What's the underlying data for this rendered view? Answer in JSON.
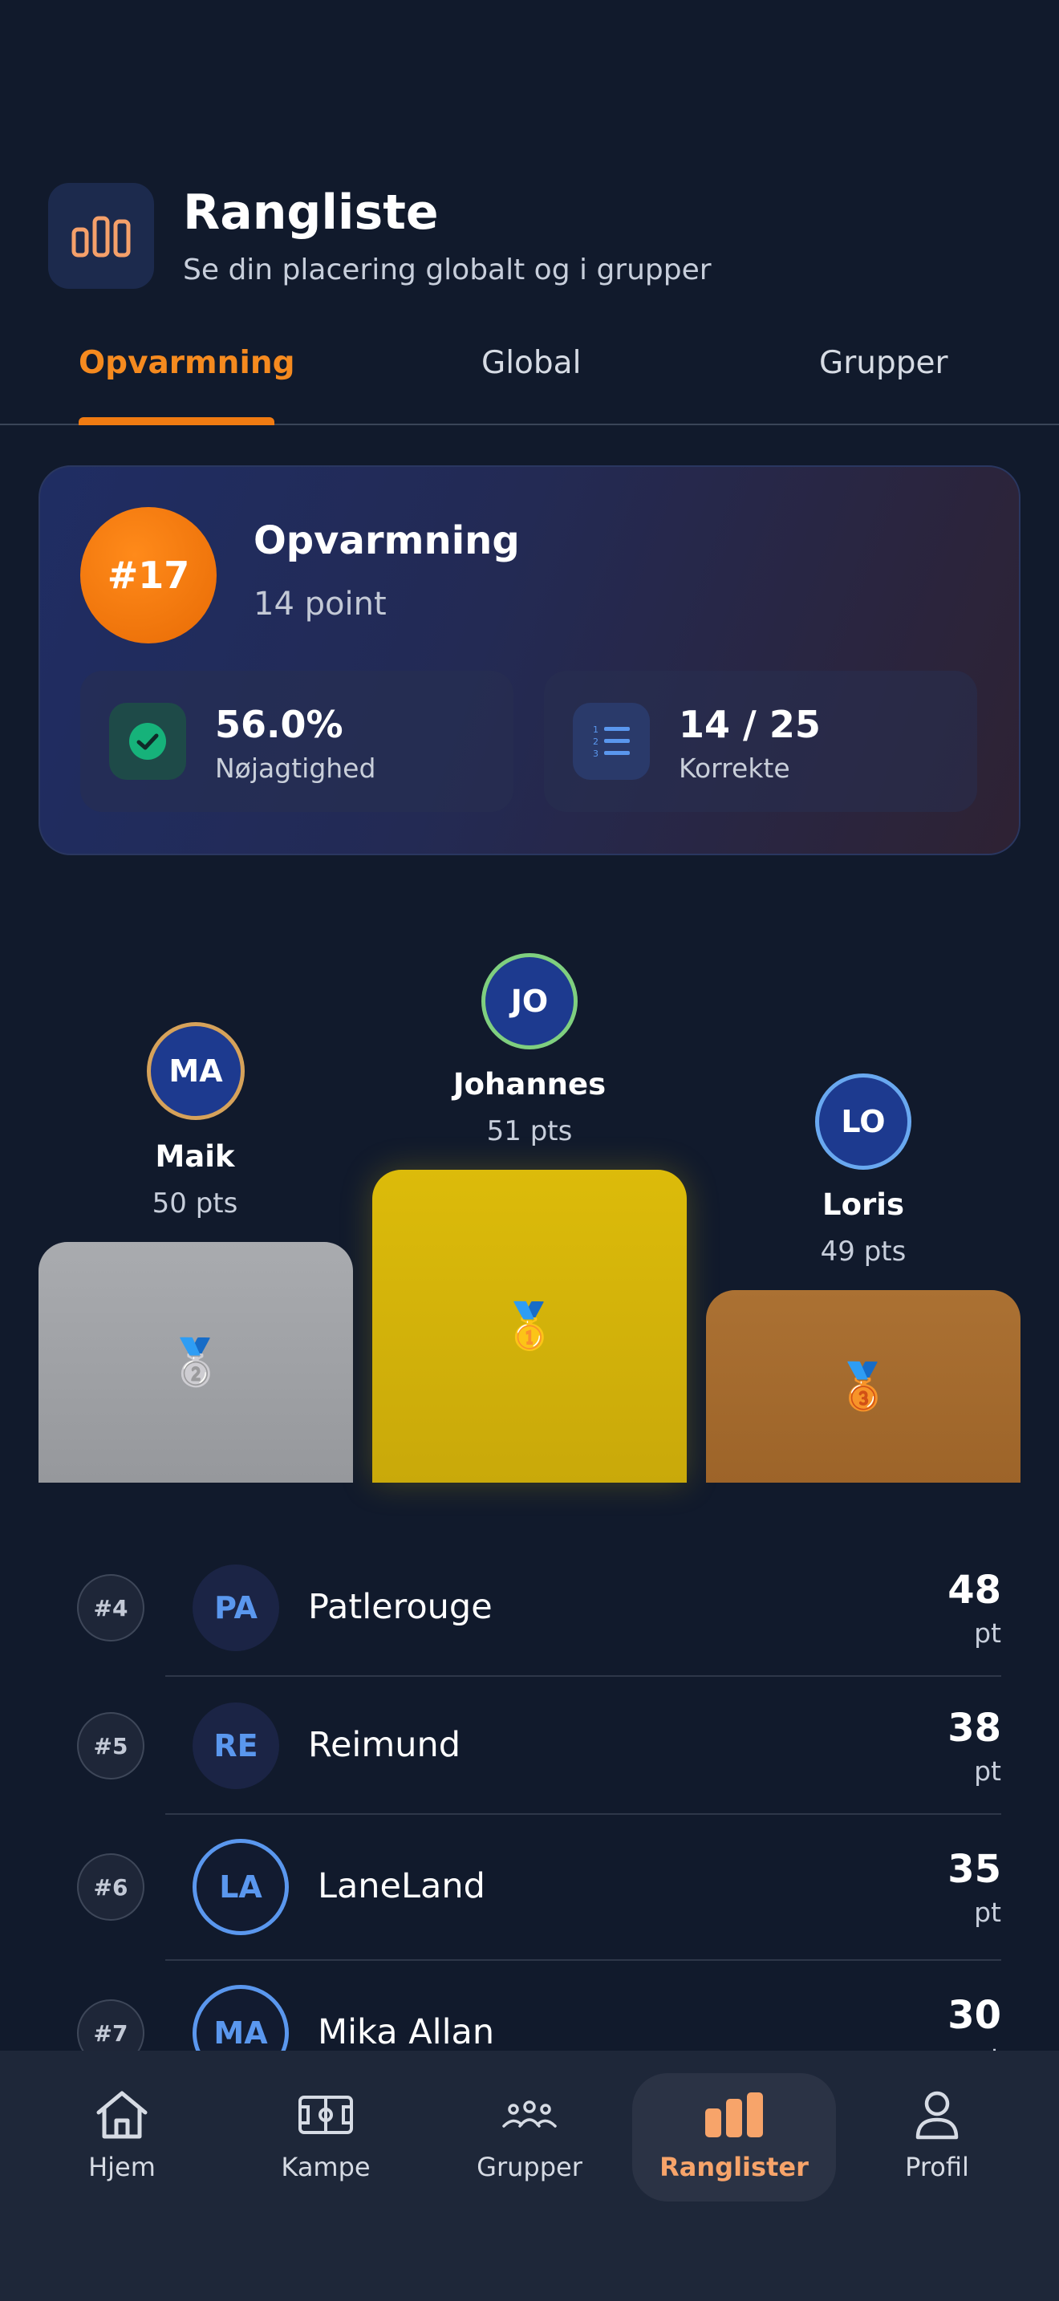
{
  "header": {
    "title": "Rangliste",
    "subtitle": "Se din placering globalt og i grupper",
    "icon": "bar-chart-icon"
  },
  "tabs": [
    {
      "label": "Opvarmning",
      "active": true
    },
    {
      "label": "Global",
      "active": false
    },
    {
      "label": "Grupper",
      "active": false
    }
  ],
  "summary": {
    "rank": "#17",
    "title": "Opvarmning",
    "points": "14 point",
    "stats": [
      {
        "value": "56.0%",
        "label": "Nøjagtighed",
        "icon": "check-circle-icon"
      },
      {
        "value": "14 / 25",
        "label": "Korrekte",
        "icon": "list-icon"
      }
    ]
  },
  "podium": {
    "first": {
      "initials": "JO",
      "name": "Johannes",
      "pts": "51 pts",
      "medal": "🥇"
    },
    "second": {
      "initials": "MA",
      "name": "Maik",
      "pts": "50 pts",
      "medal": "🥈"
    },
    "third": {
      "initials": "LO",
      "name": "Loris",
      "pts": "49 pts",
      "medal": "🥉"
    }
  },
  "leaderboard": [
    {
      "rank": "#4",
      "initials": "PA",
      "name": "Patlerouge",
      "score": "48",
      "unit": "pt"
    },
    {
      "rank": "#5",
      "initials": "RE",
      "name": "Reimund",
      "score": "38",
      "unit": "pt"
    },
    {
      "rank": "#6",
      "initials": "LA",
      "name": "LaneLand",
      "score": "35",
      "unit": "pt"
    },
    {
      "rank": "#7",
      "initials": "MA",
      "name": "Mika Allan",
      "score": "30",
      "unit": "pt"
    }
  ],
  "nav": [
    {
      "label": "Hjem",
      "icon": "home-icon",
      "active": false
    },
    {
      "label": "Kampe",
      "icon": "field-icon",
      "active": false
    },
    {
      "label": "Grupper",
      "icon": "people-icon",
      "active": false
    },
    {
      "label": "Ranglister",
      "icon": "leaderboard-icon",
      "active": true
    },
    {
      "label": "Profil",
      "icon": "profile-icon",
      "active": false
    }
  ],
  "colors": {
    "accent": "#f07b12",
    "background": "#111a2c",
    "gold": "#d9b70a",
    "silver": "#a4a6aa",
    "bronze": "#a76b32"
  }
}
